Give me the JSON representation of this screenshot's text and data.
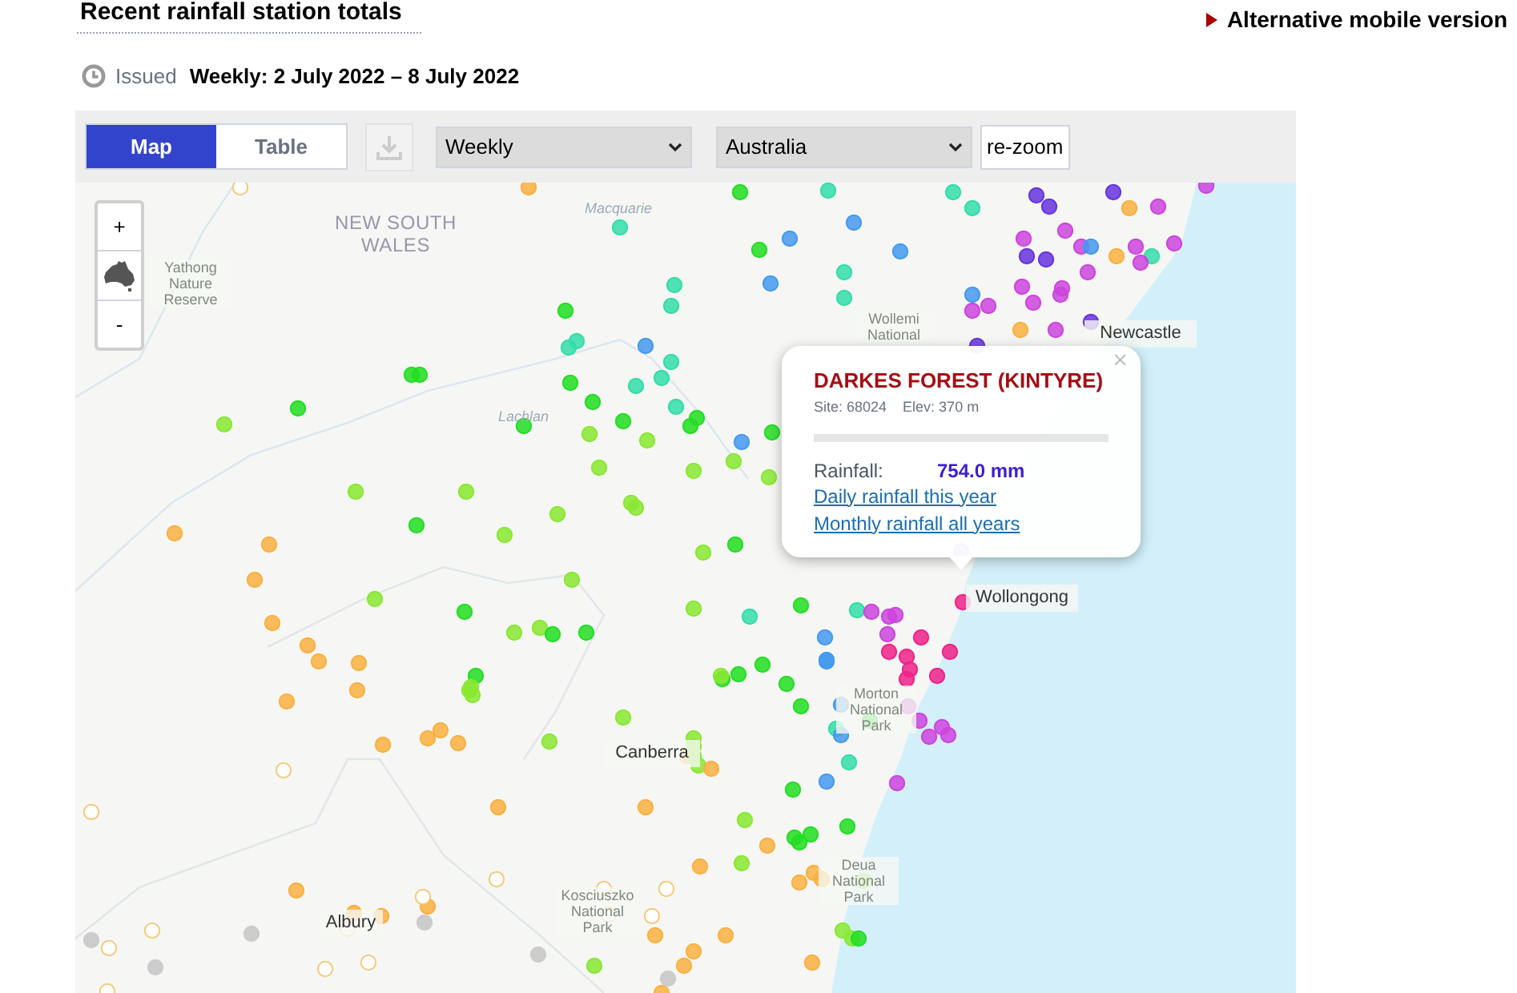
{
  "header": {
    "title": "Recent rainfall station totals",
    "issued_label": "Issued",
    "period": "Weekly: 2 July 2022 – 8 July 2022",
    "mobile_link": "Alternative mobile version"
  },
  "toolbar": {
    "view_tabs": [
      {
        "label": "Map",
        "selected": true
      },
      {
        "label": "Table",
        "selected": false
      }
    ],
    "period_select": "Weekly",
    "region_select": "Australia",
    "rezoom_button": "re-zoom"
  },
  "map": {
    "zoom_in": "+",
    "zoom_out": "-",
    "place_labels": [
      {
        "kind": "state",
        "text": "NEW SOUTH WALES"
      },
      {
        "kind": "park",
        "text": "Yathong Nature Reserve"
      },
      {
        "kind": "river",
        "text": "Macquarie"
      },
      {
        "kind": "river",
        "text": "Lachlan"
      },
      {
        "kind": "park",
        "text": "Wollemi National"
      },
      {
        "kind": "city",
        "text": "Newcastle"
      },
      {
        "kind": "city",
        "text": "Wollongong"
      },
      {
        "kind": "park",
        "text": "Morton National Park"
      },
      {
        "kind": "city",
        "text": "Canberra"
      },
      {
        "kind": "park",
        "text": "Deua National Park"
      },
      {
        "kind": "city",
        "text": "Albury"
      },
      {
        "kind": "park",
        "text": "Kosciuszko National Park"
      }
    ],
    "popup": {
      "station": "DARKES FOREST (KINTYRE)",
      "site": "Site: 68024",
      "elevation": "Elev: 370 m",
      "rainfall_label": "Rainfall:",
      "rainfall_value": "754.0 mm",
      "links": [
        "Daily rainfall this year",
        "Monthly rainfall all years"
      ],
      "close": "×"
    }
  }
}
